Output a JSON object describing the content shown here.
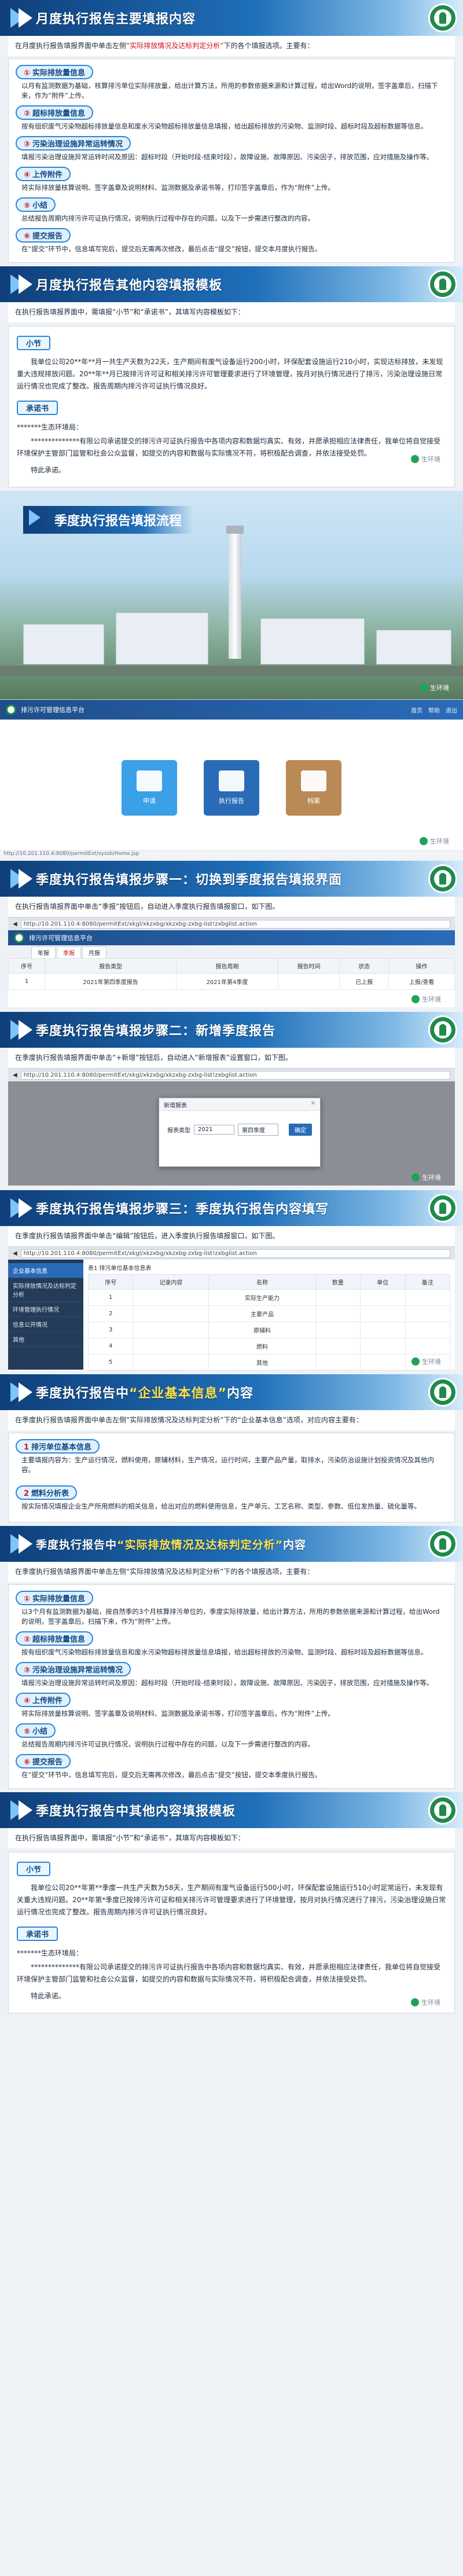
{
  "colors": {
    "banner_start": "#0f3f7a",
    "banner_end": "#d6ecfa",
    "accent_red": "#d0121b",
    "accent_blue": "#1f6fb9",
    "pill_border": "#2e86d6"
  },
  "watermark": "生环境",
  "sec1": {
    "title": "月度执行报告主要填报内容",
    "intro_a": "在月度执行报告填报界面中单击左侧",
    "intro_b": "“实际排放情况及达标判定分析”",
    "intro_c": "下的各个填报选项。主要有：",
    "items": [
      {
        "num": "①",
        "label": "实际排放量信息",
        "text": "以月有监测数据为基础，核算排污单位实际排放量，给出计算方法，所用的参数依据来源和计算过程，给出Word的说明，签字盖章后，扫描下来，作为“附件”上传。"
      },
      {
        "num": "②",
        "label": "超标排放量信息",
        "text": "按有组织废气污染物超标排放量信息和废水污染物超标排放量信息填报，给出超标排放的污染物、监测时段、超标时段及超标数据等信息。"
      },
      {
        "num": "③",
        "label": "污染治理设施异常运转情况",
        "text": "填报污染治理设施异常运转时间及原因：超标时段（开始时段-结束时段），故障设施、故障原因、污染因子，排放范围，应对措施及操作等。"
      },
      {
        "num": "④",
        "label": "上传附件",
        "text": "将实际排放量核算说明、签字盖章及说明材料、监测数据及承诺书等，打印签字盖章后，作为“附件”上传。"
      },
      {
        "num": "⑤",
        "label": "小结",
        "text": "总结报告周期内排污许可证执行情况，说明执行过程中存在的问题，以及下一步需进行整改的内容。"
      },
      {
        "num": "⑥",
        "label": "提交报告",
        "text": "在“提交”环节中，信息填写完后，提交后无需再次修改，最后点击“提交”按钮，提交本月度执行报告。"
      }
    ]
  },
  "sec2": {
    "title": "月度执行报告其他内容填报模板",
    "intro": "在执行报告填报界面中，需填报“小节”和“承诺书”，其填写内容模板如下：",
    "summary_tag": "小节",
    "summary_text": "我单位公司20**年**月一共生产天数为22天，生产期间有废气设备运行200小时，环保配套设施运行210小时，实现达标排放，未发现重大违规排放问题。20**年**月已按排污许可证和相关排污许可管理要求进行了环境管理，按月对执行情况进行了排污，污染治理设施日常运行情况也完成了整改。报告周期内排污许可证执行情况良好。",
    "promise_tag": "承诺书",
    "addressee": "*******生态环境局：",
    "promise_text": "**************有限公司承诺提交的排污许可证执行报告中各项内容和数据均真实、有效，并愿承担相应法律责任，我单位将自觉接受环境保护主管部门监管和社会公众监督，如提交的内容和数据与实际情况不符，将积极配合调查，并依法接受处罚。",
    "closing": "特此承诺。"
  },
  "hero": {
    "title": "季度执行报告填报流程"
  },
  "app1": {
    "system_name": "排污许可管理信息平台",
    "header_links": [
      "首页",
      "帮助",
      "退出"
    ],
    "tiles": [
      {
        "label": "申请",
        "color": "#3aa0e8"
      },
      {
        "label": "执行报告",
        "color": "#2a6bb8"
      },
      {
        "label": "档案",
        "color": "#b98956"
      }
    ],
    "status_url": "http://10.201.110.4:8080/permitExt/syssb/Home.jsp"
  },
  "step1": {
    "title": "季度执行报告填报步骤一：切换到季度报告填报界面",
    "intro": "在执行报告填报界面中单击“季报”按钮后，自动进入季度执行报告填报窗口，如下图。",
    "url": "http://10.201.110.4:8080/permitExt/xkgl/xkzxbg/xkzxbg-zxbg-list!zxbglist.action",
    "tabs": [
      "年报",
      "季报",
      "月报"
    ],
    "columns": [
      "序号",
      "报告类型",
      "报告周期",
      "报告时间",
      "状态",
      "操作"
    ],
    "rows": [
      [
        "1",
        "2021年第四季度报告",
        "2021年第4季度",
        "",
        "已上报",
        "上报/查看"
      ]
    ]
  },
  "step2": {
    "title": "季度执行报告填报步骤二：新增季度报告",
    "intro": "在季度执行报告填报界面中单击“+新增”按钮后，自动进入“新增报表”设置窗口，如下图。",
    "modal_title": "新增报表",
    "field_label": "报表类型",
    "year": "2021",
    "quarter": "第四季度",
    "ok": "确定"
  },
  "step3": {
    "title": "季度执行报告填报步骤三：季度执行报告内容填写",
    "intro": "在季度执行报告填报界面中单击“编辑”按钮后，进入季度执行报告填报窗口，如下图。",
    "sidebar": [
      "企业基本信息",
      "实际排放情况及达标判定分析",
      "环境管理执行情况",
      "信息公开情况",
      "其他"
    ],
    "subtitle": "表1 排污单位基本信息表",
    "columns": [
      "序号",
      "记录内容",
      "名称",
      "数量",
      "单位",
      "备注"
    ],
    "rows": [
      [
        "1",
        "",
        "实际生产能力",
        "",
        "",
        ""
      ],
      [
        "2",
        "",
        "主要产品",
        "",
        "",
        ""
      ],
      [
        "3",
        "",
        "原辅料",
        "",
        "",
        ""
      ],
      [
        "4",
        "",
        "燃料",
        "",
        "",
        ""
      ],
      [
        "5",
        "",
        "其他",
        "",
        "",
        ""
      ]
    ]
  },
  "sec_basic": {
    "title_a": "季度执行报告中",
    "title_hl": "“企业基本信息”",
    "title_b": "内容",
    "intro": "在季度执行报告填报界面中单击左侧“实际排放情况及达标判定分析”下的“企业基本信息”选项，对应内容主要有：",
    "items": [
      {
        "num": "1",
        "label": "排污单位基本信息",
        "text": "主要填报内容为：生产运行情况，燃料使用，原辅材料，生产情况，运行时间，主要产品产量，取排水，污染防治设施计划投资情况及其他内容。"
      },
      {
        "num": "2",
        "label": "燃料分析表",
        "text": "按实际情况填报企业生产所用燃料的相关信息，给出对应的燃料使用信息，生产单元、工艺名称、类型、参数、低位发热量、硫化量等。"
      }
    ]
  },
  "sec_actual": {
    "title_a": "季度执行报告中",
    "title_hl": "“实际排放情况及达标判定分析”",
    "title_b": "内容",
    "intro": "在季度执行报告填报界面中单击左侧“实际排放情况及达标判定分析”下的各个填报选项，主要有：",
    "items": [
      {
        "num": "①",
        "label": "实际排放量信息",
        "text": "以3个月有监测数据为基础，按自然季的3个月核算排污单位的，季度实际排放量，给出计算方法，所用的参数依据来源和计算过程，给出Word的说明，签字盖章后，扫描下来，作为“附件”上传。"
      },
      {
        "num": "②",
        "label": "超标排放量信息",
        "text": "按有组织废气污染物超标排放量信息和废水污染物超标排放量信息填报，给出超标排放的污染物、监测时段、超标时段及超标数据等信息。"
      },
      {
        "num": "③",
        "label": "污染治理设施异常运转情况",
        "text": "填报污染治理设施异常运转时间及原因：超标时段（开始时段-结束时段），故障设施、故障原因、污染因子，排放范围，应对措施及操作等。"
      },
      {
        "num": "④",
        "label": "上传附件",
        "text": "将实际排放量核算说明、签字盖章及说明材料、监测数据及承诺书等，打印签字盖章后，作为“附件”上传。"
      },
      {
        "num": "⑤",
        "label": "小结",
        "text": "总结报告周期内排污许可证执行情况，说明执行过程中存在的问题，以及下一步需进行整改的内容。"
      },
      {
        "num": "⑥",
        "label": "提交报告",
        "text": "在“提交”环节中，信息填写完后，提交后无需再次修改，最后点击“提交”按钮，提交本季度执行报告。"
      }
    ]
  },
  "sec_other": {
    "title": "季度执行报告中其他内容填报模板",
    "intro": "在执行报告填报界面中，需填报“小节”和“承诺书”，其填写内容模板如下：",
    "summary_tag": "小节",
    "summary_text": "我单位公司20**年第**季度一共生产天数为58天，生产期间有废气设备运行500小时，环保配套设施运行510小时足常运行，未发现有关重大违规问题。20**年第*季度已按排污许可证和相关排污许可管理要求进行了环境管理，按月对执行情况进行了排污，污染治理设施日常运行情况也完成了整改。报告周期内排污许可证执行情况良好。",
    "promise_tag": "承诺书",
    "addressee": "*******生态环境局：",
    "promise_text": "**************有限公司承诺提交的排污许可证执行报告中各项内容和数据均真实、有效，并愿承担相应法律责任，我单位将自觉接受环境保护主管部门监管和社会公众监督，如提交的内容和数据与实际情况不符，将积极配合调查，并依法接受处罚。",
    "closing": "特此承诺。"
  }
}
